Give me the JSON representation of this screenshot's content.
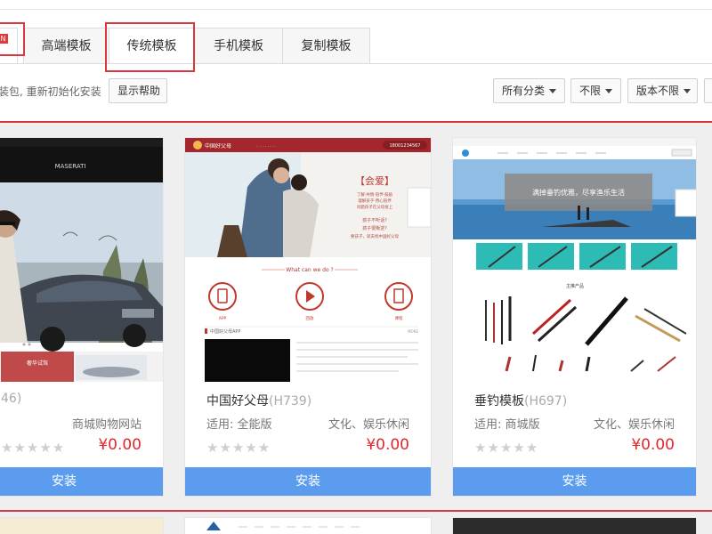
{
  "tabs": [
    {
      "label": "",
      "badge": "N"
    },
    {
      "label": "高端模板"
    },
    {
      "label": "传统模板"
    },
    {
      "label": "手机模板"
    },
    {
      "label": "复制模板"
    }
  ],
  "toolbar": {
    "hint": "装包, 重新初始化安装",
    "help_button": "显示帮助",
    "filters": [
      "所有分类",
      "不限",
      "版本不限",
      ""
    ]
  },
  "cards": [
    {
      "name": "",
      "code": "46)",
      "fit": "",
      "category": "商城购物网站",
      "price": "¥0.00",
      "install": "安装",
      "thumb": {
        "brand": "MASERATI",
        "banner": "奢华试驾"
      }
    },
    {
      "name": "中国好父母",
      "code": "(H739)",
      "fit": "适用: 全能版",
      "category": "文化、娱乐休闲",
      "price": "¥0.00",
      "install": "安装",
      "thumb": {
        "logo": "中国好父母",
        "phone": "18001234567",
        "heading": "【会爱】",
        "lines": [
          "了解·共情·陪伴·鼓励",
          "理解孩子·用心陪伴",
          "问题孩子在父母身上",
          "孩子不听话?",
          "孩子很叛逆?",
          "要孩子，就去找中国好父母"
        ],
        "section": "What can we do ?",
        "icons": [
          "APP",
          "回放",
          "课程"
        ],
        "news_title": "中国好父母APP",
        "news_more": "MORE"
      }
    },
    {
      "name": "垂钓模板",
      "code": "(H697)",
      "fit": "适用: 商城版",
      "category": "文化、娱乐休闲",
      "price": "¥0.00",
      "install": "安装",
      "thumb": {
        "banner": "满掉垂钓优雅，尽享渔乐生活",
        "section": "主推产品"
      }
    }
  ],
  "stars": "★★★★★",
  "colors": {
    "accent_red": "#d33a3f",
    "install_blue": "#5b9cee",
    "price_red": "#e3262b"
  }
}
